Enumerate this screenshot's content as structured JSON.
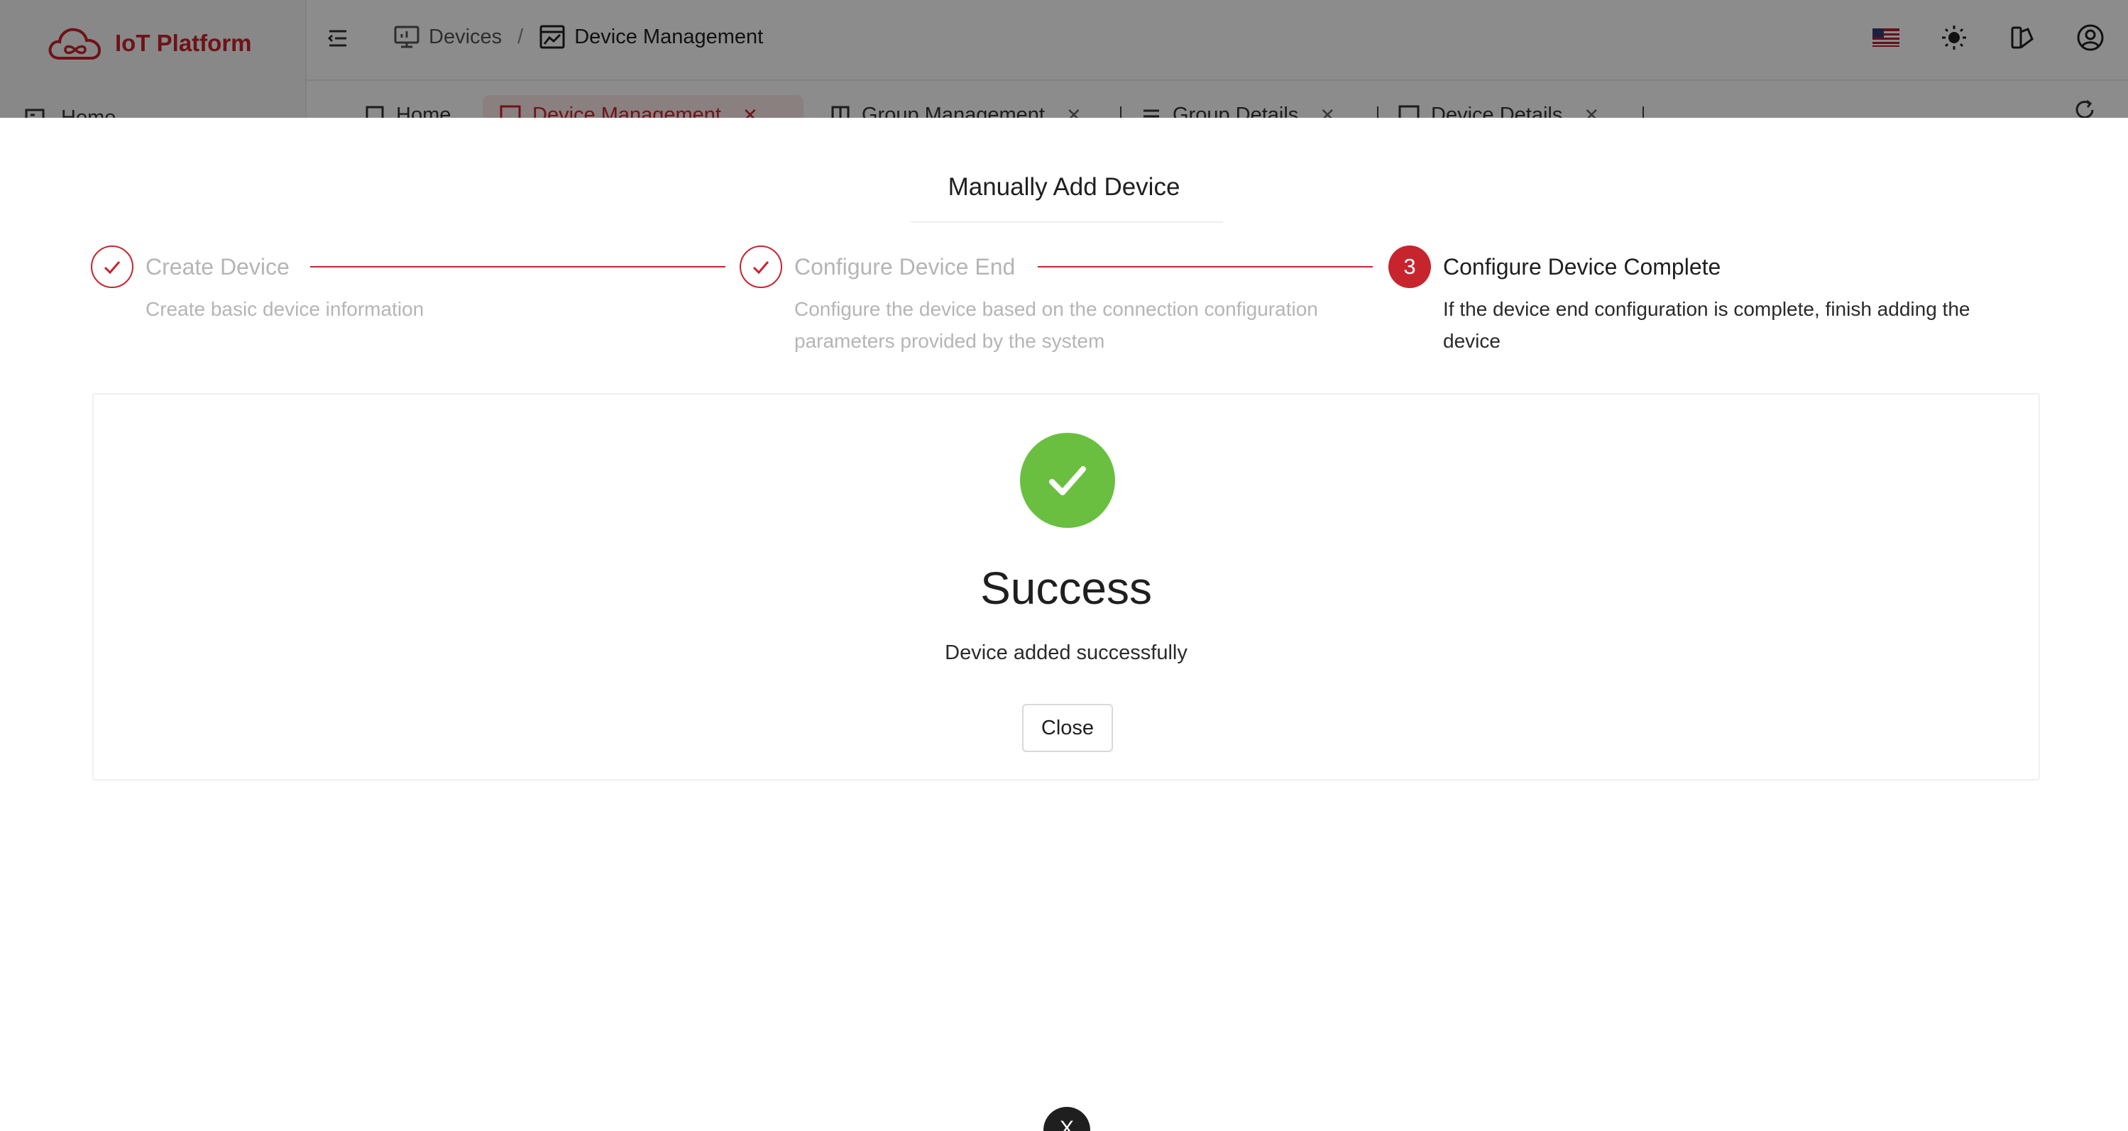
{
  "app": {
    "title": "IoT Platform",
    "accent_color": "#c8242d",
    "success_color": "#6abf40"
  },
  "header": {
    "breadcrumb": [
      {
        "label": "Devices",
        "icon": "monitor-icon"
      },
      {
        "label": "Device Management",
        "icon": "chart-window-icon"
      }
    ],
    "separator": "/",
    "icons": [
      "us-flag-icon",
      "sun-icon",
      "theme-palette-icon",
      "user-account-icon"
    ]
  },
  "tabs": [
    {
      "label": "Home",
      "icon": "home-icon"
    },
    {
      "label": "Device Management",
      "icon": "chart-window-icon",
      "active": true
    },
    {
      "label": "Group Management",
      "icon": "grid-icon"
    },
    {
      "label": "Group Details",
      "icon": "list-icon"
    },
    {
      "label": "Device Details",
      "icon": "monitor-icon"
    }
  ],
  "sidebar": {
    "items": [
      {
        "label": "Home",
        "icon": "home-icon"
      }
    ]
  },
  "modal": {
    "title": "Manually Add Device",
    "steps": [
      {
        "number": "1",
        "title": "Create Device",
        "description": "Create basic device information",
        "status": "finished"
      },
      {
        "number": "2",
        "title": "Configure Device End",
        "description": "Configure the device based on the connection configuration parameters provided by the system",
        "status": "finished"
      },
      {
        "number": "3",
        "title": "Configure Device Complete",
        "description": "If the device end configuration is complete, finish adding the device",
        "status": "current"
      }
    ],
    "result": {
      "title": "Success",
      "subtitle": "Device added successfully",
      "close_label": "Close"
    },
    "dismiss_label": "X"
  }
}
